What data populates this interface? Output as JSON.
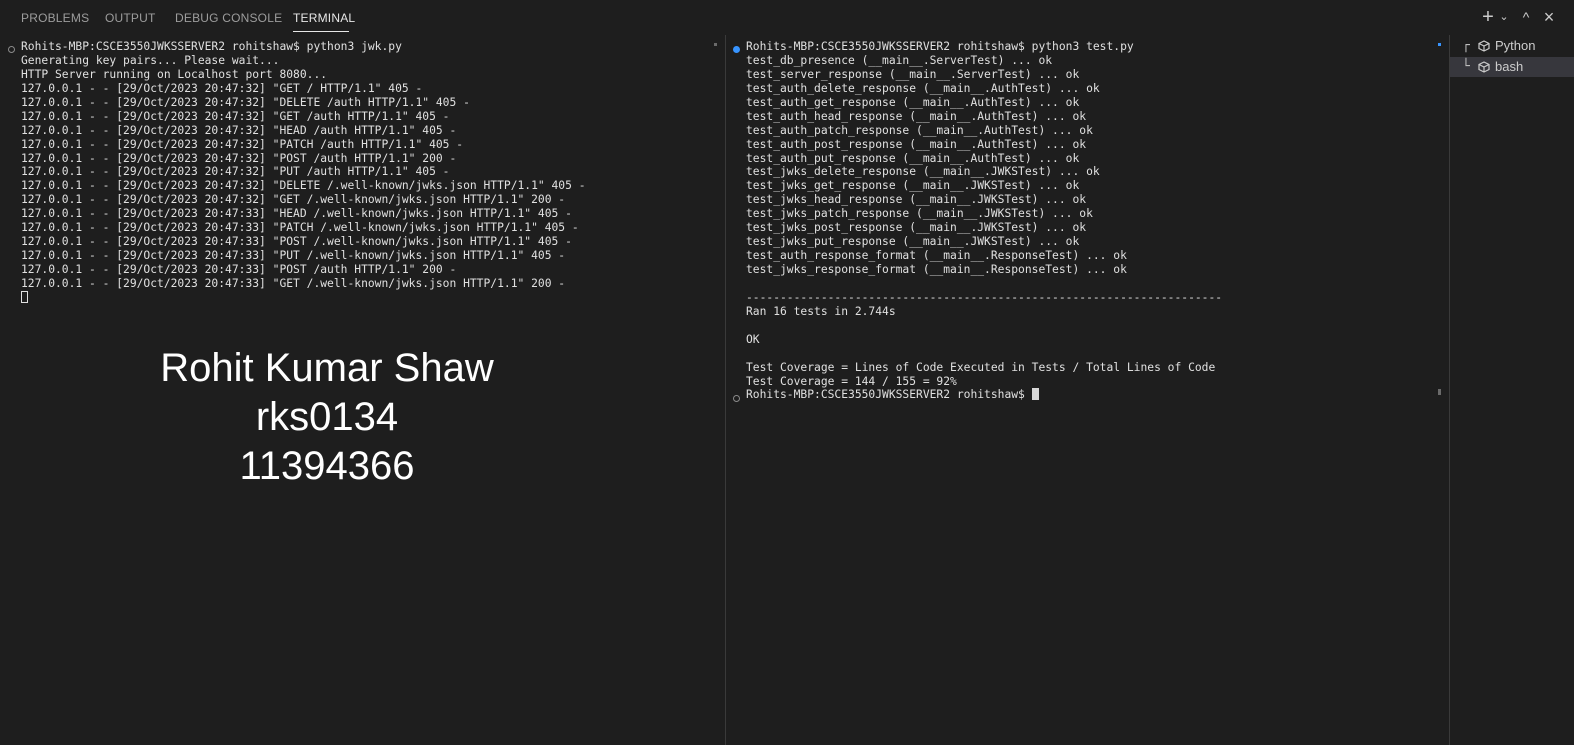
{
  "tabs": [
    {
      "label": "PROBLEMS",
      "active": false
    },
    {
      "label": "OUTPUT",
      "active": false
    },
    {
      "label": "DEBUG CONSOLE",
      "active": false
    },
    {
      "label": "TERMINAL",
      "active": true
    }
  ],
  "actions": {
    "add": "+",
    "dropdown": "⌄",
    "maximize": "^",
    "close": "×"
  },
  "left_terminal": {
    "lines": [
      "Rohits-MBP:CSCE3550JWKSSERVER2 rohitshaw$ python3 jwk.py",
      "Generating key pairs... Please wait...",
      "HTTP Server running on Localhost port 8080...",
      "127.0.0.1 - - [29/Oct/2023 20:47:32] \"GET / HTTP/1.1\" 405 -",
      "127.0.0.1 - - [29/Oct/2023 20:47:32] \"DELETE /auth HTTP/1.1\" 405 -",
      "127.0.0.1 - - [29/Oct/2023 20:47:32] \"GET /auth HTTP/1.1\" 405 -",
      "127.0.0.1 - - [29/Oct/2023 20:47:32] \"HEAD /auth HTTP/1.1\" 405 -",
      "127.0.0.1 - - [29/Oct/2023 20:47:32] \"PATCH /auth HTTP/1.1\" 405 -",
      "127.0.0.1 - - [29/Oct/2023 20:47:32] \"POST /auth HTTP/1.1\" 200 -",
      "127.0.0.1 - - [29/Oct/2023 20:47:32] \"PUT /auth HTTP/1.1\" 405 -",
      "127.0.0.1 - - [29/Oct/2023 20:47:32] \"DELETE /.well-known/jwks.json HTTP/1.1\" 405 -",
      "127.0.0.1 - - [29/Oct/2023 20:47:32] \"GET /.well-known/jwks.json HTTP/1.1\" 200 -",
      "127.0.0.1 - - [29/Oct/2023 20:47:33] \"HEAD /.well-known/jwks.json HTTP/1.1\" 405 -",
      "127.0.0.1 - - [29/Oct/2023 20:47:33] \"PATCH /.well-known/jwks.json HTTP/1.1\" 405 -",
      "127.0.0.1 - - [29/Oct/2023 20:47:33] \"POST /.well-known/jwks.json HTTP/1.1\" 405 -",
      "127.0.0.1 - - [29/Oct/2023 20:47:33] \"PUT /.well-known/jwks.json HTTP/1.1\" 405 -",
      "127.0.0.1 - - [29/Oct/2023 20:47:33] \"POST /auth HTTP/1.1\" 200 -",
      "127.0.0.1 - - [29/Oct/2023 20:47:33] \"GET /.well-known/jwks.json HTTP/1.1\" 200 -"
    ]
  },
  "overlay": {
    "name": "Rohit Kumar Shaw",
    "username": "rks0134",
    "student_id": "11394366"
  },
  "right_terminal": {
    "lines": [
      "Rohits-MBP:CSCE3550JWKSSERVER2 rohitshaw$ python3 test.py",
      "test_db_presence (__main__.ServerTest) ... ok",
      "test_server_response (__main__.ServerTest) ... ok",
      "test_auth_delete_response (__main__.AuthTest) ... ok",
      "test_auth_get_response (__main__.AuthTest) ... ok",
      "test_auth_head_response (__main__.AuthTest) ... ok",
      "test_auth_patch_response (__main__.AuthTest) ... ok",
      "test_auth_post_response (__main__.AuthTest) ... ok",
      "test_auth_put_response (__main__.AuthTest) ... ok",
      "test_jwks_delete_response (__main__.JWKSTest) ... ok",
      "test_jwks_get_response (__main__.JWKSTest) ... ok",
      "test_jwks_head_response (__main__.JWKSTest) ... ok",
      "test_jwks_patch_response (__main__.JWKSTest) ... ok",
      "test_jwks_post_response (__main__.JWKSTest) ... ok",
      "test_jwks_put_response (__main__.JWKSTest) ... ok",
      "test_auth_response_format (__main__.ResponseTest) ... ok",
      "test_jwks_response_format (__main__.ResponseTest) ... ok",
      "",
      "----------------------------------------------------------------------",
      "Ran 16 tests in 2.744s",
      "",
      "OK",
      "",
      "Test Coverage = Lines of Code Executed in Tests / Total Lines of Code",
      "Test Coverage = 144 / 155 = 92%"
    ],
    "prompt": "Rohits-MBP:CSCE3550JWKSSERVER2 rohitshaw$ "
  },
  "terminal_list": [
    {
      "label": "Python",
      "selected": false,
      "icon": "cube-icon"
    },
    {
      "label": "bash",
      "selected": true,
      "icon": "cube-icon"
    }
  ],
  "colors": {
    "background": "#1e1e1e",
    "accent_dot": "#3794ff",
    "text": "#e0e0e0"
  }
}
